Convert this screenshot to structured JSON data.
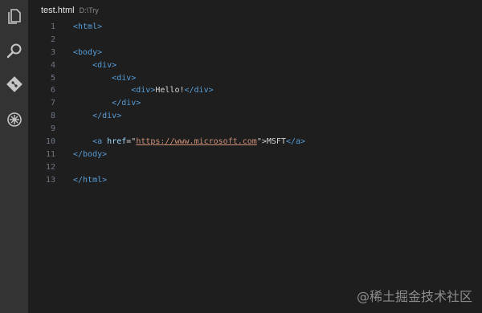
{
  "tab": {
    "file_name": "test.html",
    "path": "D:\\Try"
  },
  "activity_icons": [
    "files-icon",
    "search-icon",
    "git-icon",
    "debug-icon"
  ],
  "colors": {
    "tag": "#569cd6",
    "attr": "#9cdcfe",
    "string": "#ce9178",
    "text": "#d4d4d4",
    "line_number": "#6e7681"
  },
  "code": {
    "line_numbers": [
      "1",
      "2",
      "3",
      "4",
      "5",
      "6",
      "7",
      "8",
      "9",
      "10",
      "11",
      "12",
      "13"
    ],
    "l1": "<html>",
    "l3": "<body>",
    "l4": "<div>",
    "l5": "<div>",
    "l6_open": "<div>",
    "l6_text": "Hello!",
    "l6_close": "</div>",
    "l7": "</div>",
    "l8": "</div>",
    "l10_open": "<a",
    "l10_attr": "href",
    "l10_eq": "=\"",
    "l10_url": "https://www.microsoft.com",
    "l10_endq": "\">",
    "l10_text": "MSFT",
    "l10_close": "</a>",
    "l11": "</body>",
    "l13": "</html>"
  },
  "watermark": "@稀土掘金技术社区"
}
